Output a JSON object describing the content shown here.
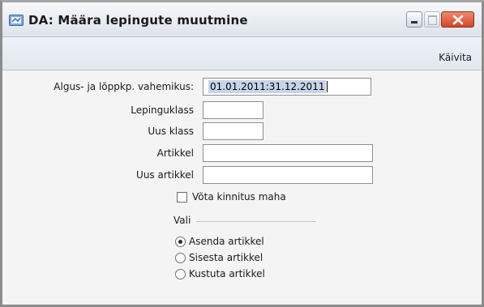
{
  "window": {
    "title": "DA: Määra lepingute muutmine",
    "icon": "register-app-icon",
    "controls": [
      "minimize-icon",
      "maximize-icon",
      "close-icon"
    ]
  },
  "toolbar": {
    "run_label": "Käivita"
  },
  "form": {
    "period_label": "Algus- ja lõppkp. vahemikus:",
    "period_value": "01.01.2011:31.12.2011",
    "contract_class_label": "Lepinguklass",
    "contract_class_value": "",
    "new_class_label": "Uus klass",
    "new_class_value": "",
    "article_label": "Artikkel",
    "article_value": "",
    "new_article_label": "Uus artikkel",
    "new_article_value": "",
    "remove_approval_label": "Võta kinnitus maha",
    "remove_approval_checked": false
  },
  "choice": {
    "group_label": "Vali",
    "options": [
      {
        "label": "Asenda artikkel",
        "selected": true
      },
      {
        "label": "Sisesta artikkel",
        "selected": false
      },
      {
        "label": "Kustuta artikkel",
        "selected": false
      }
    ]
  },
  "colors": {
    "close_button": "#d2462a",
    "selection": "#c7d5e8"
  }
}
